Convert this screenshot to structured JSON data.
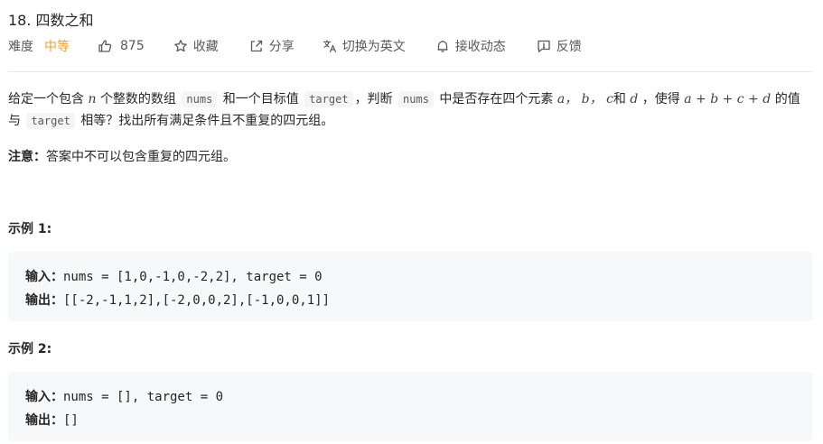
{
  "problem": {
    "title": "18. 四数之和",
    "difficulty_label": "难度",
    "difficulty_value": "中等",
    "likes": "875",
    "favorite_label": "收藏",
    "share_label": "分享",
    "translate_label": "切换为英文",
    "follow_label": "接收动态",
    "feedback_label": "反馈"
  },
  "description": {
    "p1": "给定一个包含",
    "var_n": "n",
    "p2": "个整数的数组",
    "code_nums": "nums",
    "p3": "和一个目标值",
    "code_target": "target",
    "p4": "，判断",
    "code_nums2": "nums",
    "p5": "中是否存在四个元素",
    "var_a": "a，",
    "var_b": "b，",
    "var_c": "c",
    "p6": "和",
    "var_d": "d",
    "p7": "，使得",
    "expr": "a + b + c + d",
    "p8": "的值与",
    "code_target2": "target",
    "p9": "相等？找出所有满足条件且不重复的四元组。"
  },
  "note": {
    "label": "注意：",
    "text": "答案中不可以包含重复的四元组。"
  },
  "examples": [
    {
      "title": "示例 1:",
      "input_label": "输入：",
      "input": "nums = [1,0,-1,0,-2,2], target = 0",
      "output_label": "输出：",
      "output": "[[-2,-1,1,2],[-2,0,0,2],[-1,0,0,1]]"
    },
    {
      "title": "示例 2:",
      "input_label": "输入：",
      "input": "nums = [], target = 0",
      "output_label": "输出：",
      "output": "[]"
    }
  ],
  "colors": {
    "difficulty_medium": "#f59e2e",
    "example_bg": "#f7f8fa",
    "divider": "#e8e8e8"
  },
  "icons": [
    "thumbs-up-icon",
    "star-icon",
    "share-icon",
    "translate-icon",
    "bell-icon",
    "feedback-icon"
  ]
}
